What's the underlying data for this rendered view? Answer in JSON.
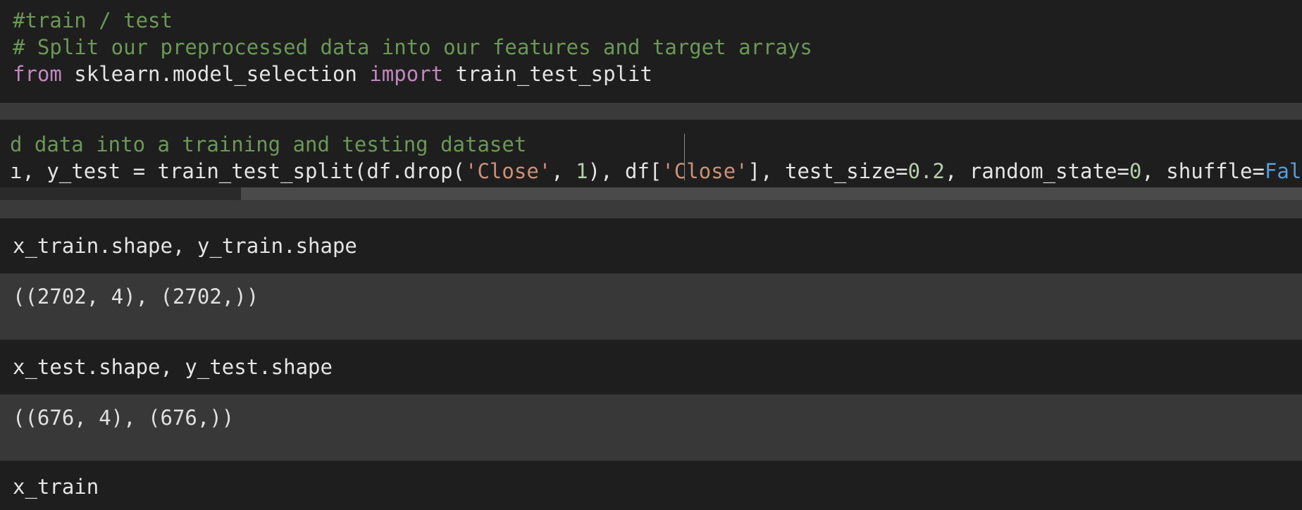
{
  "cell1": {
    "line1": "#train / test",
    "line2": "# Split our preprocessed data into our features and target arrays",
    "line3": {
      "kw_from": "from",
      "module": " sklearn.model_selection ",
      "kw_import": "import",
      "name": " train_test_split"
    }
  },
  "cell2": {
    "line1": "d data into a training and testing dataset",
    "line2": {
      "p1": "ı, y_test = train_test_split(df.drop(",
      "s1": "'Close'",
      "p2": ", ",
      "n1": "1",
      "p3": "), df[",
      "s2": "'Close'",
      "p4": "], test_size=",
      "n2": "0.2",
      "p5": ", random_state=",
      "n3": "0",
      "p6": ", shuffle=",
      "b1": "False",
      "p7": ")"
    }
  },
  "cell3": {
    "code": "x_train.shape, y_train.shape",
    "output": "((2702, 4), (2702,))"
  },
  "cell4": {
    "code": "x_test.shape, y_test.shape",
    "output": "((676, 4), (676,))"
  },
  "cell5": {
    "code": "x_train"
  },
  "colors": {
    "background": "#1e1e1e",
    "comment": "#6a9955",
    "keyword": "#c586c0",
    "string": "#ce9178",
    "number": "#b5cea8",
    "boolean": "#569cd6"
  }
}
